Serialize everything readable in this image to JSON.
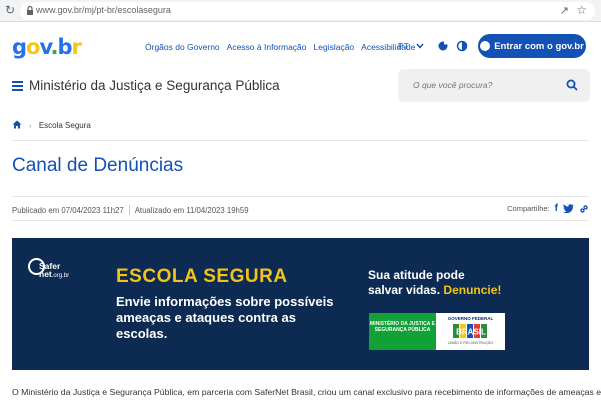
{
  "browser": {
    "url": "www.gov.br/mj/pt-br/escolasegura"
  },
  "header": {
    "logo": {
      "g": "g",
      "o": "o",
      "v": "v",
      "dot": ".",
      "b": "b",
      "r": "r"
    },
    "nav_links": [
      "Órgãos do Governo",
      "Acesso à Informação",
      "Legislação",
      "Acessibilidade"
    ],
    "language": "PT",
    "login_label": "Entrar com o gov.br",
    "ministry": "Ministério da Justiça e Segurança Pública",
    "search_placeholder": "O que você procura?"
  },
  "breadcrumb": {
    "current": "Escola Segura"
  },
  "page": {
    "title": "Canal de Denúncias",
    "published": "Publicado em 07/04/2023 11h27",
    "updated": "Atualizado em 11/04/2023 19h59",
    "share_label": "Compartilhe:"
  },
  "banner": {
    "safer_brand": "Safer",
    "safer_net": "net",
    "safer_domain": ".org.br",
    "title": "ESCOLA SEGURA",
    "subtitle": "Envie informações sobre possíveis ameaças e ataques contra as escolas.",
    "right_line1": "Sua atitude pode",
    "right_line2": "salvar vidas.",
    "right_highlight": "Denuncie!",
    "mjsp_label": "MINISTÉRIO DA JUSTIÇA E SEGURANÇA PÚBLICA",
    "gov_fed_label": "GOVERNO FEDERAL",
    "brasil_label": "BRASIL",
    "gov_fed_motto": "UNIÃO E RECONSTRUÇÃO"
  },
  "intro_text": "O Ministério da Justiça e Segurança Pública, em parceria com SaferNet Brasil, criou um canal exclusivo para recebimento de informações de ameaças e",
  "colors": {
    "primary": "#1351b4",
    "banner_bg": "#0c2a52",
    "banner_yellow": "#f2c318",
    "mjsp_green": "#12a136"
  }
}
